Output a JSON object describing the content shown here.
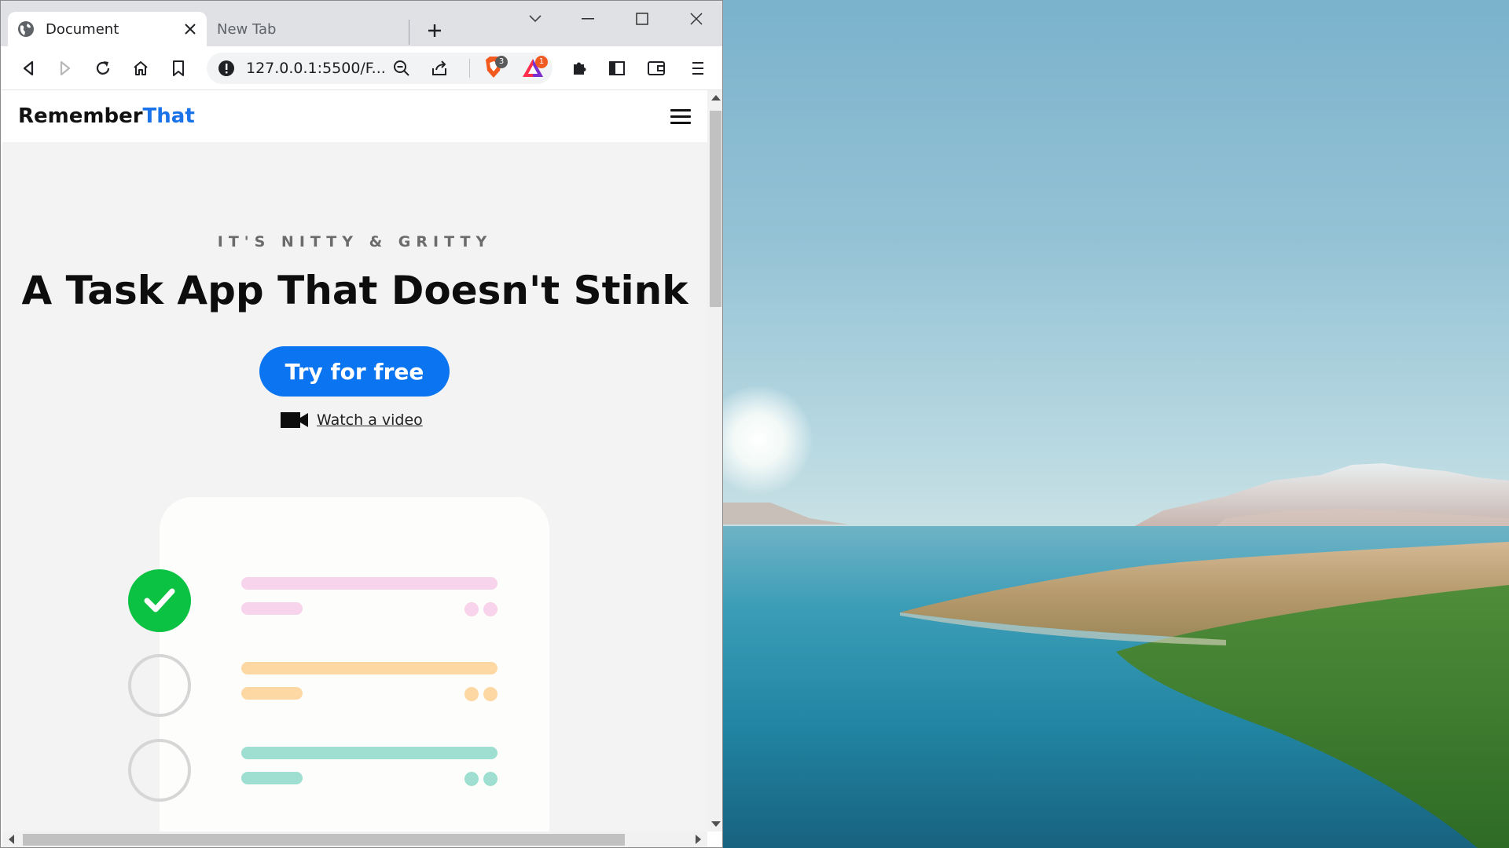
{
  "browser": {
    "tabs": [
      {
        "title": "Document",
        "active": true
      },
      {
        "title": "New Tab",
        "active": false
      }
    ],
    "address_bar": {
      "url": "127.0.0.1:5500/F..."
    },
    "brave_shields_count": "3",
    "rewards_count": "1"
  },
  "site": {
    "brand": {
      "name": "Remember",
      "accent": "That"
    },
    "hero": {
      "eyebrow": "IT'S NITTY & GRITTY",
      "headline": "A Task App That Doesn't Stink",
      "cta_label": "Try for free",
      "video_link": "Watch a video"
    },
    "illustration": {
      "tasks": [
        {
          "state": "done",
          "color": "#f7d3ec",
          "accent": "#f7d3ec"
        },
        {
          "state": "open",
          "color": "#fdd8a3",
          "accent": "#fdd8a3"
        },
        {
          "state": "open",
          "color": "#9fdfd2",
          "accent": "#9fdfd2"
        }
      ]
    }
  },
  "colors": {
    "brand_accent": "#1a73e8",
    "cta": "#0b74f0",
    "check": "#0bc242"
  },
  "icons": [
    "globe-icon",
    "close-icon",
    "plus-icon",
    "back-icon",
    "forward-icon",
    "reload-icon",
    "home-icon",
    "bookmark-icon",
    "info-icon",
    "zoom-icon",
    "share-icon",
    "brave-shield-icon",
    "brave-rewards-icon",
    "extensions-icon",
    "sidebar-icon",
    "wallet-icon",
    "menu-icon",
    "hamburger-icon",
    "video-camera-icon",
    "check-icon"
  ]
}
